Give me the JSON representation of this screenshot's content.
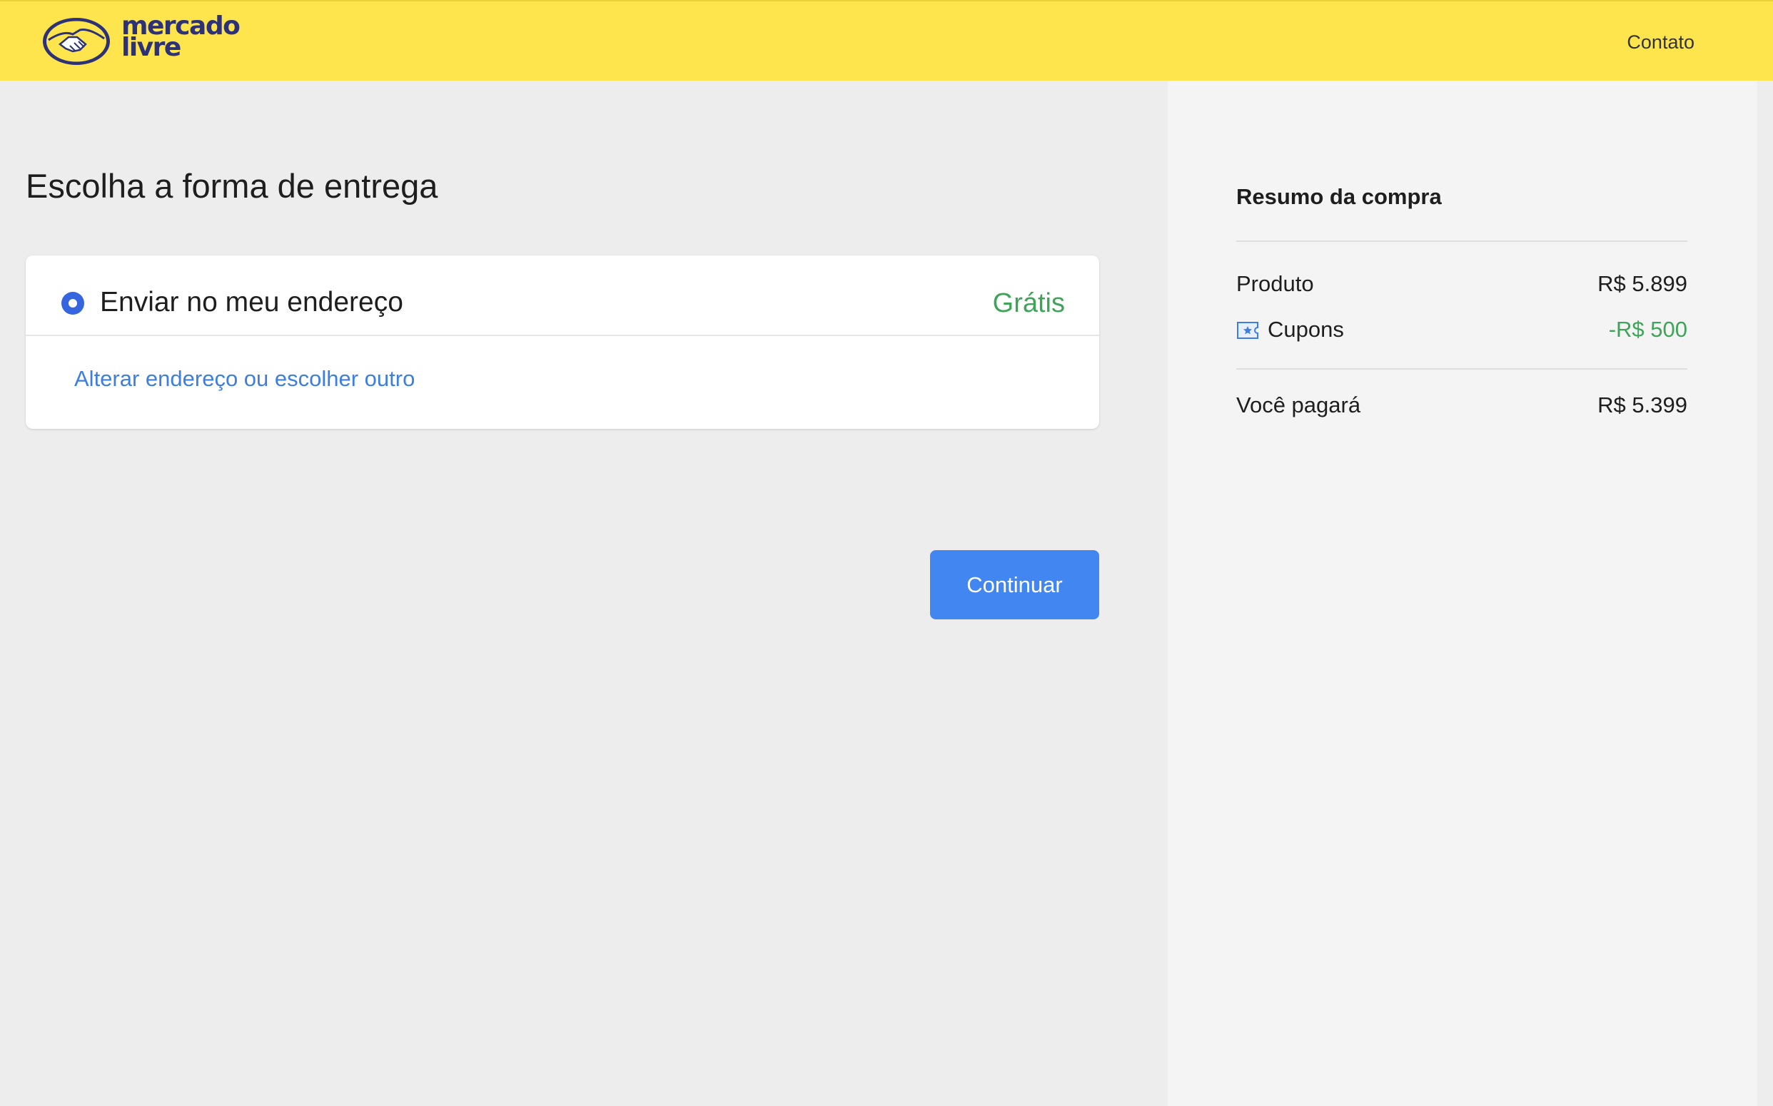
{
  "header": {
    "logo_line1": "mercado",
    "logo_line2": "livre",
    "contact_label": "Contato",
    "bg_color": "#fee54d"
  },
  "main": {
    "title": "Escolha a forma de entrega",
    "option": {
      "label": "Enviar no meu endereço",
      "price": "Grátis",
      "selected": true,
      "change_link": "Alterar endereço ou escolher outro"
    },
    "continue_label": "Continuar"
  },
  "summary": {
    "title": "Resumo da compra",
    "rows": [
      {
        "label": "Produto",
        "value": "R$ 5.899"
      },
      {
        "label": "Cupons",
        "value": "-R$ 500",
        "icon": "coupon-icon"
      }
    ],
    "total": {
      "label": "Você pagará",
      "value": "R$ 5.399"
    }
  },
  "colors": {
    "accent_blue": "#4286f1",
    "link_blue": "#3d7ee0",
    "green": "#40a35a"
  }
}
